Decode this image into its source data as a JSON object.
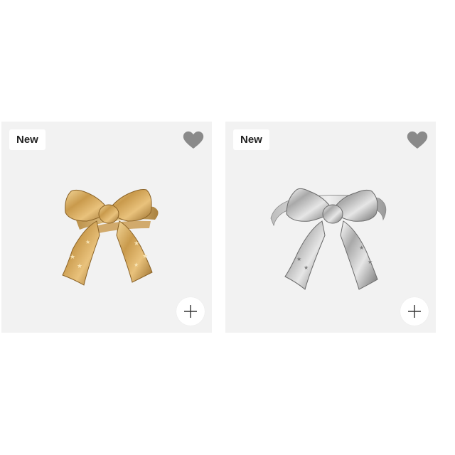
{
  "products": [
    {
      "badge": "New",
      "image": "gold-bow-ring",
      "metal_color": "#c99a4c",
      "wishlist_icon": "heart-icon",
      "add_icon": "plus-icon"
    },
    {
      "badge": "New",
      "image": "silver-bow-ring",
      "metal_color": "#c4c4c4",
      "wishlist_icon": "heart-icon",
      "add_icon": "plus-icon"
    }
  ],
  "colors": {
    "card_background": "#f2f2f2",
    "heart": "#8a8a8a",
    "badge_text": "#222222"
  }
}
